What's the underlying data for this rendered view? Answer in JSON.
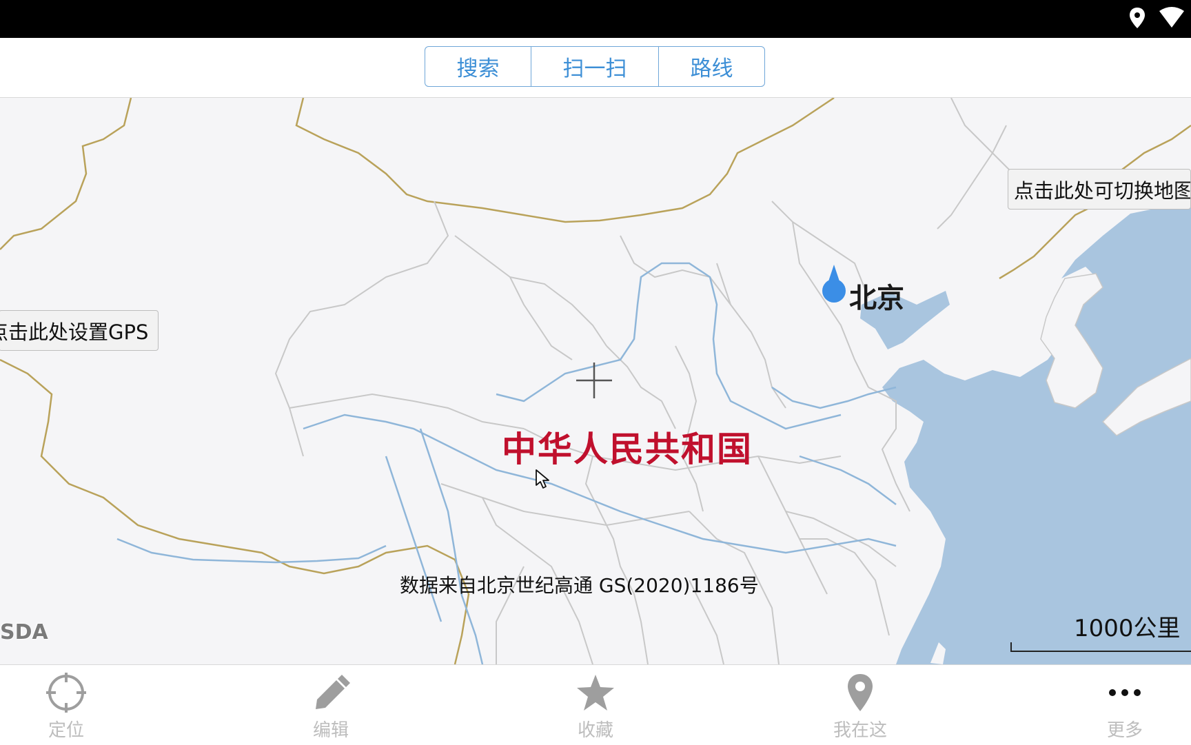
{
  "status_bar": {
    "icons": [
      "location-pin-icon",
      "wifi-icon"
    ],
    "background": "#000000"
  },
  "toolbar": {
    "segments": [
      {
        "label": "搜索"
      },
      {
        "label": "扫一扫"
      },
      {
        "label": "路线"
      }
    ],
    "accent": "#3d8fd6"
  },
  "map": {
    "country_label": "中华人民共和国",
    "city_label": "北京",
    "attribution": "数据来自北京世纪高通  GS(2020)1186号",
    "watermark": "SDA",
    "scale_label": "1000公里",
    "gps_callout": "点击此处设置GPS",
    "switch_callout": "点击此处可切换地图",
    "colors": {
      "land": "#f5f5f7",
      "water": "#a9c5df",
      "river": "#8fb6d9",
      "national_border": "#b9a25a",
      "province_border": "#c8c8c8",
      "country_label": "#c0102d",
      "marker": "#3b8ee6"
    }
  },
  "bottom_nav": {
    "items": [
      {
        "label": "定位",
        "icon": "locate-crosshair-icon"
      },
      {
        "label": "编辑",
        "icon": "pencil-icon"
      },
      {
        "label": "收藏",
        "icon": "star-icon"
      },
      {
        "label": "我在这",
        "icon": "map-pin-icon"
      },
      {
        "label": "更多",
        "icon": "more-dots-icon"
      }
    ]
  }
}
